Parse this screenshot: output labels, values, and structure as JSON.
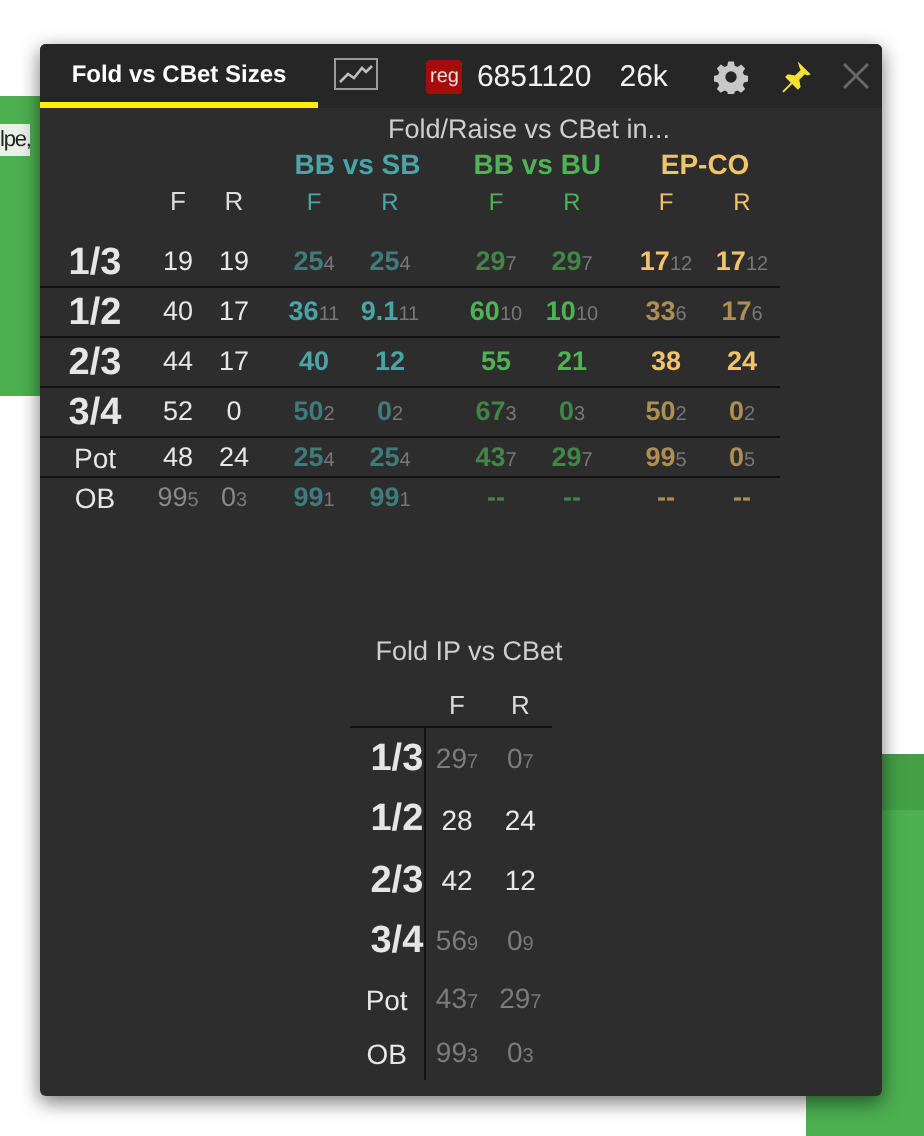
{
  "background": {
    "left_texts": [
      "lpe,"
    ]
  },
  "tabs": [
    {
      "kind": "text",
      "label": "Fold vs CBet Sizes",
      "selected": true
    },
    {
      "kind": "chart",
      "selected": false
    }
  ],
  "player": {
    "badge": "reg",
    "id": "6851120",
    "hands": "26k"
  },
  "pinned": true,
  "main_table": {
    "title": "Fold/Raise vs CBet in...",
    "base_columns": [
      "F",
      "R"
    ],
    "groups": [
      {
        "name": "BB vs SB",
        "color": "#4aa6a6",
        "columns": [
          "F",
          "R"
        ]
      },
      {
        "name": "BB vs BU",
        "color": "#4fb356",
        "columns": [
          "F",
          "R"
        ]
      },
      {
        "name": "EP-CO",
        "color": "#f2c46a",
        "columns": [
          "F",
          "R"
        ]
      }
    ],
    "rows": [
      {
        "label": "1/3",
        "kind": "major",
        "cells": [
          {
            "v": "19",
            "dim": false
          },
          {
            "v": "19",
            "dim": false
          },
          {
            "v": "25",
            "n": "4",
            "dim": true
          },
          {
            "v": "25",
            "n": "4",
            "dim": true
          },
          {
            "v": "29",
            "n": "7",
            "dim": true
          },
          {
            "v": "29",
            "n": "7",
            "dim": true
          },
          {
            "v": "17",
            "n": "12",
            "dim": false
          },
          {
            "v": "17",
            "n": "12",
            "dim": false
          }
        ]
      },
      {
        "label": "1/2",
        "kind": "major",
        "cells": [
          {
            "v": "40",
            "dim": false
          },
          {
            "v": "17",
            "dim": false
          },
          {
            "v": "36",
            "n": "11",
            "dim": false
          },
          {
            "v": "9.1",
            "n": "11",
            "dim": false
          },
          {
            "v": "60",
            "n": "10",
            "dim": false
          },
          {
            "v": "10",
            "n": "10",
            "dim": false
          },
          {
            "v": "33",
            "n": "6",
            "dim": true
          },
          {
            "v": "17",
            "n": "6",
            "dim": true
          }
        ]
      },
      {
        "label": "2/3",
        "kind": "major",
        "cells": [
          {
            "v": "44",
            "dim": false
          },
          {
            "v": "17",
            "dim": false
          },
          {
            "v": "40",
            "dim": false
          },
          {
            "v": "12",
            "dim": false
          },
          {
            "v": "55",
            "dim": false
          },
          {
            "v": "21",
            "dim": false
          },
          {
            "v": "38",
            "dim": false
          },
          {
            "v": "24",
            "dim": false
          }
        ]
      },
      {
        "label": "3/4",
        "kind": "major",
        "cells": [
          {
            "v": "52",
            "dim": false
          },
          {
            "v": "0",
            "dim": false
          },
          {
            "v": "50",
            "n": "2",
            "dim": true
          },
          {
            "v": "0",
            "n": "2",
            "dim": true
          },
          {
            "v": "67",
            "n": "3",
            "dim": true
          },
          {
            "v": "0",
            "n": "3",
            "dim": true
          },
          {
            "v": "50",
            "n": "2",
            "dim": true
          },
          {
            "v": "0",
            "n": "2",
            "dim": true
          }
        ]
      },
      {
        "label": "Pot",
        "kind": "minor",
        "cells": [
          {
            "v": "48",
            "dim": false
          },
          {
            "v": "24",
            "dim": false
          },
          {
            "v": "25",
            "n": "4",
            "dim": true
          },
          {
            "v": "25",
            "n": "4",
            "dim": true
          },
          {
            "v": "43",
            "n": "7",
            "dim": true
          },
          {
            "v": "29",
            "n": "7",
            "dim": true
          },
          {
            "v": "99",
            "n": "5",
            "dim": true
          },
          {
            "v": "0",
            "n": "5",
            "dim": true
          }
        ]
      },
      {
        "label": "OB",
        "kind": "minor",
        "cells": [
          {
            "v": "99",
            "n": "5",
            "dim": true
          },
          {
            "v": "0",
            "n": "3",
            "dim": true
          },
          {
            "v": "99",
            "n": "1",
            "dim": true
          },
          {
            "v": "99",
            "n": "1",
            "dim": true
          },
          {
            "v": "--",
            "dim": true
          },
          {
            "v": "--",
            "dim": true
          },
          {
            "v": "--",
            "dim": true
          },
          {
            "v": "--",
            "dim": true
          }
        ]
      }
    ]
  },
  "ip_table": {
    "title": "Fold IP vs CBet",
    "columns": [
      "F",
      "R"
    ],
    "rows": [
      {
        "label": "1/3",
        "kind": "major",
        "cells": [
          {
            "v": "29",
            "n": "7",
            "dim": true
          },
          {
            "v": "0",
            "n": "7",
            "dim": true
          }
        ]
      },
      {
        "label": "1/2",
        "kind": "major",
        "cells": [
          {
            "v": "28",
            "dim": false
          },
          {
            "v": "24",
            "dim": false
          }
        ]
      },
      {
        "label": "2/3",
        "kind": "major",
        "cells": [
          {
            "v": "42",
            "dim": false
          },
          {
            "v": "12",
            "dim": false
          }
        ]
      },
      {
        "label": "3/4",
        "kind": "major",
        "cells": [
          {
            "v": "56",
            "n": "9",
            "dim": true
          },
          {
            "v": "0",
            "n": "9",
            "dim": true
          }
        ]
      },
      {
        "label": "Pot",
        "kind": "minor",
        "cells": [
          {
            "v": "43",
            "n": "7",
            "dim": true
          },
          {
            "v": "29",
            "n": "7",
            "dim": true
          }
        ]
      },
      {
        "label": "OB",
        "kind": "minor",
        "cells": [
          {
            "v": "99",
            "n": "3",
            "dim": true
          },
          {
            "v": "0",
            "n": "3",
            "dim": true
          }
        ]
      }
    ]
  }
}
